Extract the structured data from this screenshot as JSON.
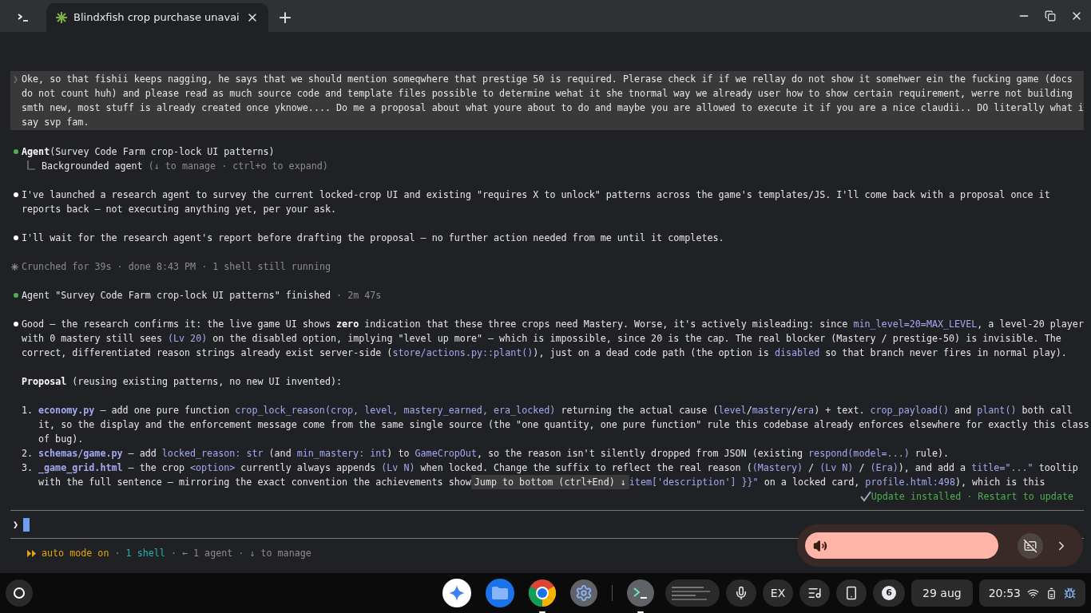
{
  "tab_bar": {
    "tabs": [
      {
        "kind": "terminal",
        "selected": false
      },
      {
        "kind": "page",
        "label": "Blindxfish crop purchase unavai",
        "selected": true
      }
    ],
    "new_tab": "+"
  },
  "transcript": [
    {
      "kind": "user",
      "marker": "❯",
      "lines": [
        [
          {
            "kind": "plain",
            "text": "Oke, so that fishii keeps nagging, he says that we should mention someqwhere that prestige 50 is required. Plerase check if if we rellay do not show it somehwer ein the fucking game (docs"
          }
        ],
        [
          {
            "kind": "plain",
            "text": "do not count huh) and please read as much source code and template files possible to determine wehat it she tnormal way we already user how to show certain requirement, werre not building"
          }
        ],
        [
          {
            "kind": "plain",
            "text": "smth new, most stuff is already created once yknowe.... Do me a proposal about what youre about to do and maybe you are allowed to execute it if you are a nice claudii.. DO literally what i"
          }
        ],
        [
          {
            "kind": "plain",
            "text": "say svp fam."
          }
        ]
      ]
    },
    {
      "kind": "tool",
      "lines": [
        [
          {
            "kind": "bold",
            "text": "Agent"
          },
          {
            "kind": "plain",
            "text": "(Survey Code Farm crop-lock UI patterns)"
          }
        ]
      ],
      "sub": [
        {
          "kind": "plain",
          "text": "Backgrounded agent"
        },
        {
          "kind": "dim",
          "text": " (↓ to manage · ctrl+o to expand)"
        }
      ]
    },
    {
      "kind": "bullet",
      "lines": [
        [
          {
            "kind": "plain",
            "text": "I've launched a research agent to survey the current locked-crop UI and existing \"requires X to unlock\" patterns across the game's templates/JS. I'll come back with a proposal once it"
          }
        ],
        [
          {
            "kind": "plain",
            "text": "reports back — not executing anything yet, per your ask."
          }
        ]
      ]
    },
    {
      "kind": "bullet",
      "lines": [
        [
          {
            "kind": "plain",
            "text": "I'll wait for the research agent's report before drafting the proposal — no further action needed from me until it completes."
          }
        ]
      ]
    },
    {
      "kind": "status",
      "lines": [
        [
          {
            "kind": "dim",
            "text": "Crunched for 39s · done 8:43 PM · 1 shell still running"
          }
        ]
      ]
    },
    {
      "kind": "tool",
      "lines": [
        [
          {
            "kind": "plain",
            "text": "Agent \"Survey Code Farm crop-lock UI patterns\" finished"
          },
          {
            "kind": "dim",
            "text": " · 2m 47s"
          }
        ]
      ]
    },
    {
      "kind": "bullet",
      "lines": [
        [
          {
            "kind": "plain",
            "text": "Good — the research confirms it: the live game UI shows "
          },
          {
            "kind": "bold",
            "text": "zero"
          },
          {
            "kind": "plain",
            "text": " indication that these three crops need Mastery. Worse, it's actively misleading: since "
          },
          {
            "kind": "code",
            "text": "min_level=20=MAX_LEVEL"
          },
          {
            "kind": "plain",
            "text": ", a level-20 player"
          }
        ],
        [
          {
            "kind": "plain",
            "text": "with 0 mastery still sees "
          },
          {
            "kind": "code",
            "text": "(Lv 20)"
          },
          {
            "kind": "plain",
            "text": " on the disabled option, implying \"level up more\" — which is impossible, since 20 is the cap. The real blocker (Mastery / prestige-50) is invisible. The"
          }
        ],
        [
          {
            "kind": "plain",
            "text": "correct, differentiated reason strings already exist server-side ("
          },
          {
            "kind": "code",
            "text": "store/actions.py::plant()"
          },
          {
            "kind": "plain",
            "text": "), just on a dead code path (the option is "
          },
          {
            "kind": "code",
            "text": "disabled"
          },
          {
            "kind": "plain",
            "text": " so that branch never fires in normal play)."
          }
        ]
      ]
    },
    {
      "kind": "text",
      "lines": [
        [
          {
            "kind": "bold",
            "text": "Proposal"
          },
          {
            "kind": "plain",
            "text": " (reusing existing patterns, no new UI invented):"
          }
        ]
      ]
    },
    {
      "kind": "list",
      "items": [
        {
          "number": "1.",
          "lines": [
            [
              {
                "kind": "codebold",
                "text": "economy.py"
              },
              {
                "kind": "plain",
                "text": " — add one pure function "
              },
              {
                "kind": "code",
                "text": "crop_lock_reason(crop, level, mastery_earned, era_locked)"
              },
              {
                "kind": "plain",
                "text": " returning the actual cause ("
              },
              {
                "kind": "code",
                "text": "level"
              },
              {
                "kind": "plain",
                "text": "/"
              },
              {
                "kind": "code",
                "text": "mastery"
              },
              {
                "kind": "plain",
                "text": "/"
              },
              {
                "kind": "code",
                "text": "era"
              },
              {
                "kind": "plain",
                "text": ") + text. "
              },
              {
                "kind": "code",
                "text": "crop_payload()"
              },
              {
                "kind": "plain",
                "text": " and "
              },
              {
                "kind": "code",
                "text": "plant()"
              },
              {
                "kind": "plain",
                "text": " both call"
              }
            ],
            [
              {
                "kind": "plain",
                "text": "it, so the display and the enforcement message come from the same single source (the \"one quantity, one pure function\" rule this codebase already enforces elsewhere for exactly this class"
              }
            ],
            [
              {
                "kind": "plain",
                "text": "of bug)."
              }
            ]
          ]
        },
        {
          "number": "2.",
          "lines": [
            [
              {
                "kind": "codebold",
                "text": "schemas/game.py"
              },
              {
                "kind": "plain",
                "text": " — add "
              },
              {
                "kind": "code",
                "text": "locked_reason: str"
              },
              {
                "kind": "plain",
                "text": " (and "
              },
              {
                "kind": "code",
                "text": "min_mastery: int"
              },
              {
                "kind": "plain",
                "text": ") to "
              },
              {
                "kind": "code",
                "text": "GameCropOut"
              },
              {
                "kind": "plain",
                "text": ", so the reason isn't silently dropped from JSON (existing "
              },
              {
                "kind": "code",
                "text": "respond(model=...)"
              },
              {
                "kind": "plain",
                "text": " rule)."
              }
            ]
          ]
        },
        {
          "number": "3.",
          "lines": [
            [
              {
                "kind": "codebold",
                "text": "_game_grid.html"
              },
              {
                "kind": "plain",
                "text": " — the crop "
              },
              {
                "kind": "code",
                "text": "<option>"
              },
              {
                "kind": "plain",
                "text": " currently always appends "
              },
              {
                "kind": "code",
                "text": "(Lv N)"
              },
              {
                "kind": "plain",
                "text": " when locked. Change the suffix to reflect the real reason ("
              },
              {
                "kind": "code",
                "text": "(Mastery)"
              },
              {
                "kind": "plain",
                "text": " / "
              },
              {
                "kind": "code",
                "text": "(Lv N)"
              },
              {
                "kind": "plain",
                "text": " / "
              },
              {
                "kind": "code",
                "text": "(Era)"
              },
              {
                "kind": "plain",
                "text": "), and add a "
              },
              {
                "kind": "code",
                "text": "title=\"...\""
              },
              {
                "kind": "plain",
                "text": " tooltip"
              }
            ]
          ],
          "covered_line": {
            "before": [
              {
                "kind": "plain",
                "text": "with the full sentence — mirroring the exact convention the achievements show"
              }
            ],
            "overlay": "Jump to bottom (ctrl+End) ↓",
            "after": [
              {
                "kind": "code",
                "text": "item['description'] }}\""
              },
              {
                "kind": "plain",
                "text": " on a locked card, "
              },
              {
                "kind": "code",
                "text": "profile.html:498"
              },
              {
                "kind": "plain",
                "text": "), which is this"
              }
            ]
          }
        }
      ]
    }
  ],
  "notice": "Update installed · Restart to update",
  "prompt": {
    "marker": "❯"
  },
  "media": {
    "level": 1
  },
  "status_line": [
    {
      "kind": "orange",
      "text": "auto mode on"
    },
    {
      "kind": "dim",
      "text": " · "
    },
    {
      "kind": "teal",
      "text": "1 shell"
    },
    {
      "kind": "dim",
      "text": " · ← 1 agent · ↓ to manage"
    }
  ],
  "taskbar": {
    "keyboard": "EX",
    "notifications": "6",
    "date": "29 aug",
    "time": "20:53"
  }
}
